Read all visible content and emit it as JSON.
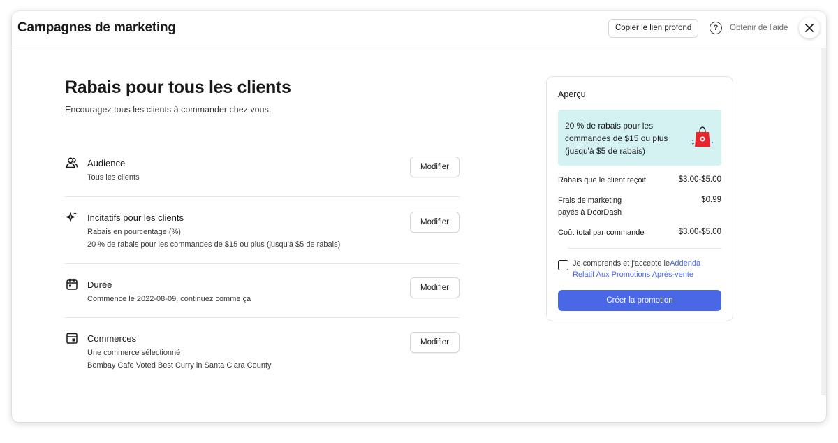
{
  "header": {
    "title": "Campagnes de marketing",
    "copy_link_label": "Copier le lien profond",
    "help_label": "Obtenir de l'aide"
  },
  "main": {
    "title": "Rabais pour tous les clients",
    "subtitle": "Encouragez tous les clients à commander chez vous.",
    "modify_label": "Modifier",
    "sections": [
      {
        "icon": "users-icon",
        "title": "Audience",
        "lines": [
          "Tous les clients"
        ]
      },
      {
        "icon": "sparkle-icon",
        "title": "Incitatifs pour les clients",
        "lines": [
          "Rabais en pourcentage (%)",
          "20 % de rabais pour les commandes de $15 ou plus (jusqu'à $5 de rabais)"
        ]
      },
      {
        "icon": "calendar-icon",
        "title": "Durée",
        "lines": [
          "Commence le 2022-08-09, continuez comme ça"
        ]
      },
      {
        "icon": "store-icon",
        "title": "Commerces",
        "lines": [
          "Une commerce sélectionné",
          "Bombay Cafe Voted Best Curry in Santa Clara County"
        ]
      }
    ]
  },
  "preview": {
    "title": "Aperçu",
    "promo_text": "20 % de rabais pour les commandes de $15 ou plus (jusqu'à $5 de rabais)",
    "promo_icon": "shopping-bag-icon",
    "rows": [
      {
        "label": "Rabais que le client reçoit",
        "value": "$3.00-$5.00"
      },
      {
        "label": "Frais de marketing payés à DoorDash",
        "value": "$0.99"
      },
      {
        "label": "Coût total par commande",
        "value": "$3.00-$5.00"
      }
    ],
    "agree_text": "Je comprends et j'accepte le",
    "agree_link": "Addenda Relatif Aux Promotions Après-vente",
    "agree_checked": false,
    "create_label": "Créer la promotion"
  },
  "colors": {
    "accent": "#4a67e6",
    "promo_bg": "#d5f2f2",
    "bag_red": "#e8252c"
  }
}
